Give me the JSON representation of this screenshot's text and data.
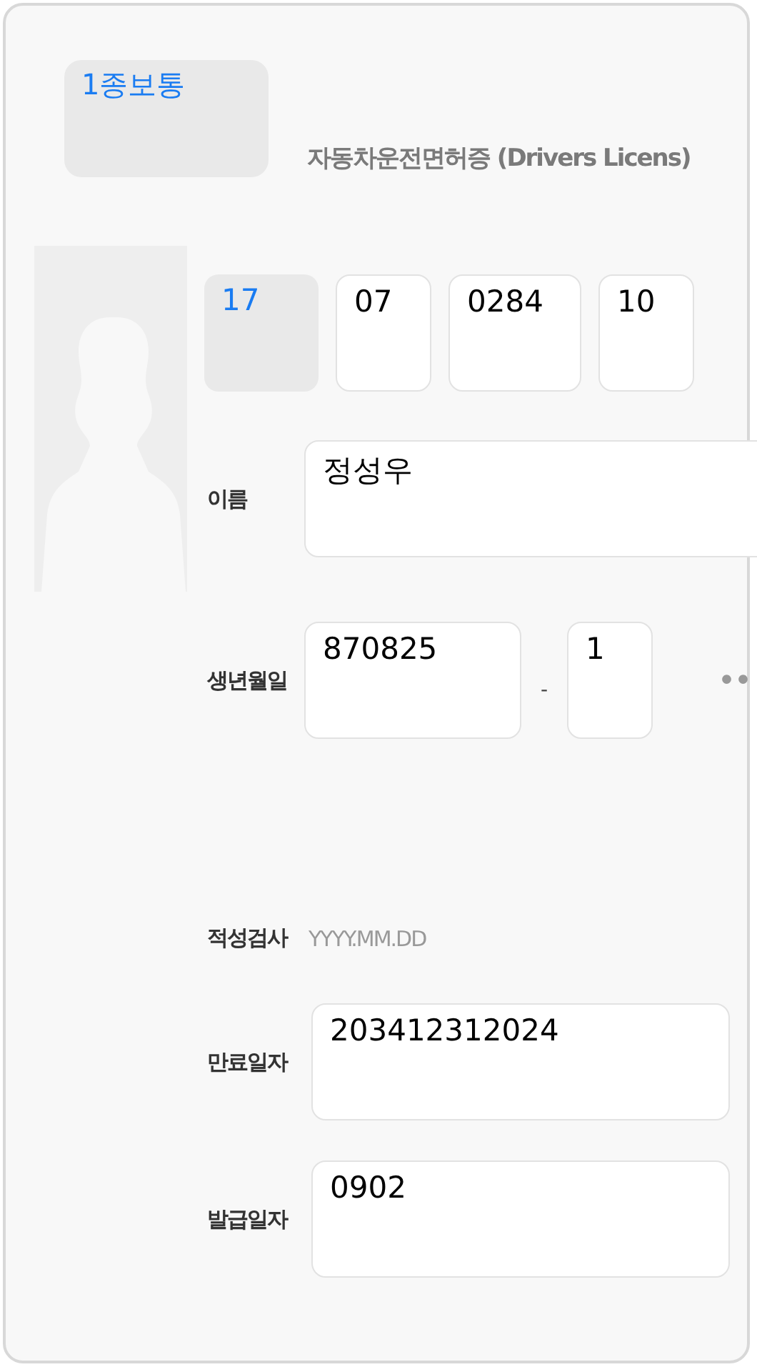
{
  "license_type": {
    "label": "1종보통"
  },
  "title": "자동차운전면허증 (Drivers Licens)",
  "license_number": [
    {
      "value": "17",
      "kind": "select"
    },
    {
      "value": "07",
      "kind": "input"
    },
    {
      "value": "0284",
      "kind": "input"
    },
    {
      "value": "10",
      "kind": "input"
    }
  ],
  "name": {
    "label": "이름",
    "value": "정성우"
  },
  "birth": {
    "label": "생년월일",
    "date": "870825",
    "separator": "-",
    "gender_digit": "1",
    "masked": "••"
  },
  "aptitude_test": {
    "label": "적성검사",
    "placeholder": "YYYY.MM.DD"
  },
  "expiry_date": {
    "label": "만료일자",
    "value": "203412312024"
  },
  "issue_date": {
    "label": "발급일자",
    "value": "0902"
  }
}
